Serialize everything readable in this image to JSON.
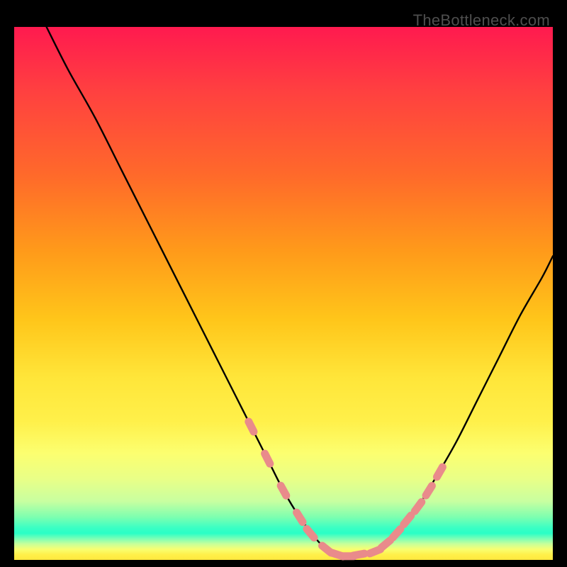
{
  "watermark": "TheBottleneck.com",
  "colors": {
    "curve_stroke": "#000000",
    "marker_fill": "#e98b8b",
    "marker_stroke": "#d66a6a"
  },
  "chart_data": {
    "type": "line",
    "title": "",
    "xlabel": "",
    "ylabel": "",
    "xlim": [
      0,
      100
    ],
    "ylim": [
      0,
      100
    ],
    "series": [
      {
        "name": "bottleneck-curve",
        "x": [
          6,
          10,
          15,
          20,
          25,
          30,
          35,
          38,
          41,
          44,
          47,
          50,
          53,
          56,
          58,
          60,
          62,
          64,
          66,
          68,
          70,
          72,
          75,
          78,
          82,
          86,
          90,
          94,
          98,
          100
        ],
        "y": [
          100,
          92,
          83,
          73,
          63,
          53,
          43,
          37,
          31,
          25,
          19,
          13,
          8,
          4,
          2,
          1,
          0.7,
          0.7,
          1,
          2,
          3.5,
          6,
          10,
          15,
          22,
          30,
          38,
          46,
          53,
          57
        ]
      }
    ],
    "markers": {
      "name": "highlighted-points",
      "x": [
        44,
        47,
        50,
        53,
        55,
        58,
        60,
        62,
        64,
        67,
        69,
        71,
        73,
        75,
        77,
        79
      ],
      "y": [
        25,
        19,
        13,
        8,
        5,
        2,
        1,
        0.7,
        1,
        1.6,
        3,
        5,
        7.5,
        10,
        13,
        16.5
      ]
    }
  }
}
